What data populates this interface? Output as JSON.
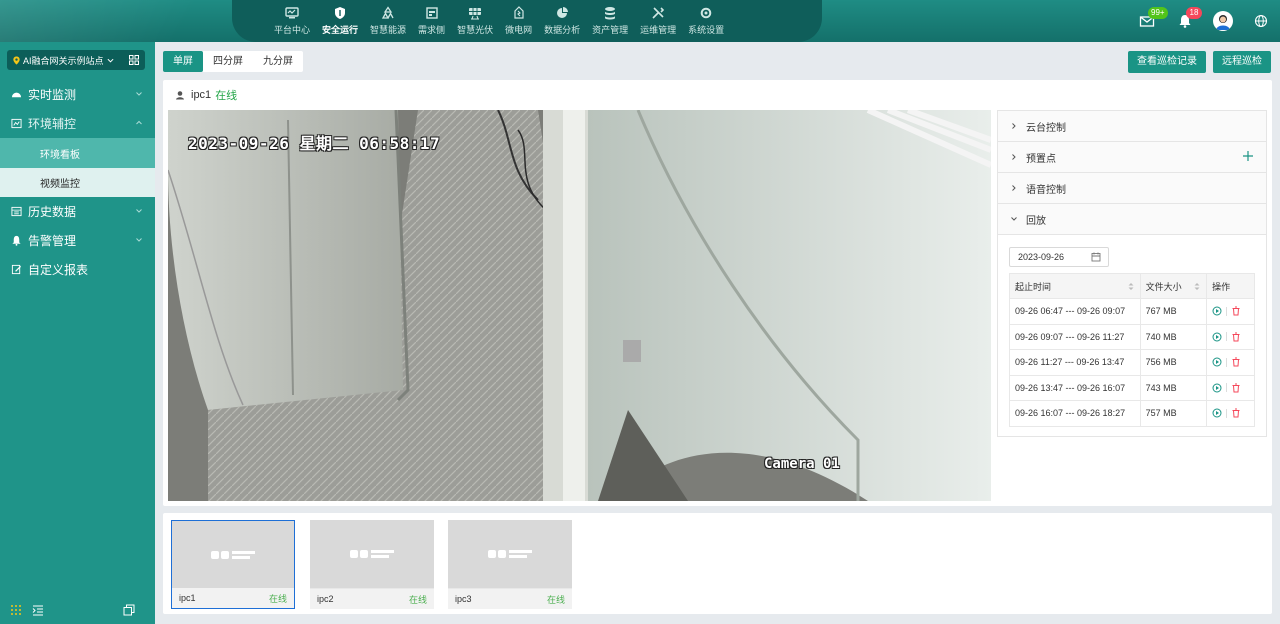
{
  "topnav": {
    "items": [
      {
        "label": "平台中心",
        "icon": "monitor-icon"
      },
      {
        "label": "安全运行",
        "icon": "shield-icon",
        "active": true
      },
      {
        "label": "智慧能源",
        "icon": "recycle-icon"
      },
      {
        "label": "需求侧",
        "icon": "calendar-icon"
      },
      {
        "label": "智慧光伏",
        "icon": "solar-panel-icon"
      },
      {
        "label": "微电网",
        "icon": "grid-icon"
      },
      {
        "label": "数据分析",
        "icon": "pie-chart-icon"
      },
      {
        "label": "资产管理",
        "icon": "database-icon"
      },
      {
        "label": "运维管理",
        "icon": "tools-icon"
      },
      {
        "label": "系统设置",
        "icon": "gear-icon"
      }
    ],
    "mail_badge": "99+",
    "bell_badge": "18"
  },
  "sidebar": {
    "station": "AI融合网关示例站点",
    "menu": {
      "realtime": "实时监测",
      "env": "环境辅控",
      "env_board": "环境看板",
      "video_monitor": "视频监控",
      "history": "历史数据",
      "alarm": "告警管理",
      "report": "自定义报表"
    }
  },
  "tabs": [
    "单屏",
    "四分屏",
    "九分屏"
  ],
  "buttons": {
    "inspection_records": "查看巡检记录",
    "remote_inspection": "远程巡检"
  },
  "camera": {
    "name": "ipc1",
    "status": "在线",
    "timestamp": "2023-09-26 星期二 06:58:17",
    "label": "Camera 01"
  },
  "control": {
    "ptz": "云台控制",
    "presets": "预置点",
    "voice": "语音控制",
    "playback": "回放",
    "date": "2023-09-26",
    "columns": [
      "起止时间",
      "文件大小",
      "操作"
    ],
    "records": [
      {
        "time": "09-26 06:47 --- 09-26 09:07",
        "size": "767 MB"
      },
      {
        "time": "09-26 09:07 --- 09-26 11:27",
        "size": "740 MB"
      },
      {
        "time": "09-26 11:27 --- 09-26 13:47",
        "size": "756 MB"
      },
      {
        "time": "09-26 13:47 --- 09-26 16:07",
        "size": "743 MB"
      },
      {
        "time": "09-26 16:07 --- 09-26 18:27",
        "size": "757 MB"
      }
    ]
  },
  "thumbnails": [
    {
      "name": "ipc1",
      "status": "在线",
      "selected": true
    },
    {
      "name": "ipc2",
      "status": "在线"
    },
    {
      "name": "ipc3",
      "status": "在线"
    }
  ],
  "colors": {
    "primary": "#1a9485",
    "online": "#23a548",
    "delete": "#f5475a"
  }
}
